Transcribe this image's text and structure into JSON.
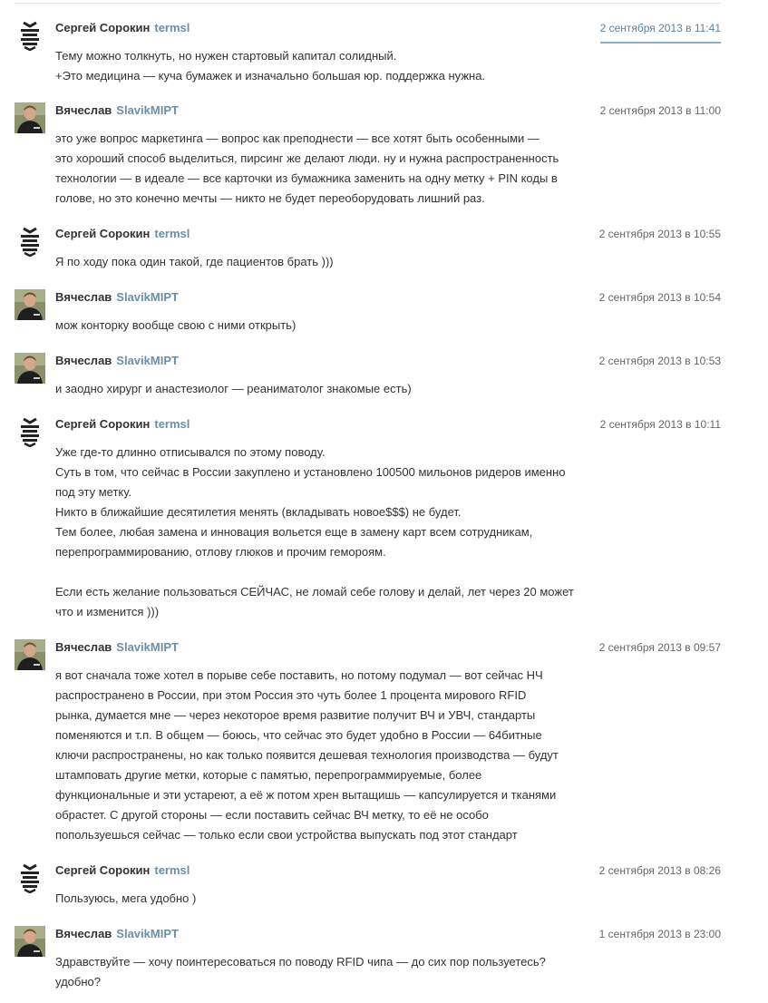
{
  "comments": [
    {
      "author": "Сергей Сорокин",
      "nick": "termsl",
      "avatar": "logo-avatar",
      "time": "2 сентября 2013 в 11:41",
      "active": true,
      "lines": [
        "Тему можно толкнуть, но нужен стартовый капитал солидный.",
        "+Это медицина — куча бумажек и изначально большая юр. поддержка нужна."
      ]
    },
    {
      "author": "Вячеслав",
      "nick": "SlavikMIPT",
      "avatar": "person-avatar",
      "time": "2 сентября 2013 в 11:00",
      "active": false,
      "lines": [
        "это уже вопрос маркетинга — вопрос как преподнести — все хотят быть особенными —",
        "это хороший способ выделиться, пирсинг же делают люди. ну и нужна распространенность",
        "технологии — в идеале — все карточки из бумажника заменить на одну метку + PIN коды в",
        "голове, но это конечно мечты — никто не будет переоборудовать лишний раз."
      ]
    },
    {
      "author": "Сергей Сорокин",
      "nick": "termsl",
      "avatar": "logo-avatar",
      "time": "2 сентября 2013 в 10:55",
      "active": false,
      "lines": [
        "Я по ходу пока один такой, где пациентов брать )))"
      ]
    },
    {
      "author": "Вячеслав",
      "nick": "SlavikMIPT",
      "avatar": "person-avatar",
      "time": "2 сентября 2013 в 10:54",
      "active": false,
      "lines": [
        "мож конторку вообще свою с ними открыть)"
      ]
    },
    {
      "author": "Вячеслав",
      "nick": "SlavikMIPT",
      "avatar": "person-avatar",
      "time": "2 сентября 2013 в 10:53",
      "active": false,
      "lines": [
        "и заодно хирург и анастезиолог — реаниматолог знакомые есть)"
      ]
    },
    {
      "author": "Сергей Сорокин",
      "nick": "termsl",
      "avatar": "logo-avatar",
      "time": "2 сентября 2013 в 10:11",
      "active": false,
      "lines": [
        "Уже где-то длинно отписывался по этому поводу.",
        "Суть в том, что сейчас в России закуплено и установлено 100500 мильонов ридеров именно",
        "под эту метку.",
        "Никто в ближайшие десятилетия менять (вкладывать новое$$$) не будет.",
        "Тем более, любая замена и инновация вольется еще в замену карт всем сотрудникам,",
        "перепрограммированию, отлову глюков и прочим гемороям.",
        "",
        "Если есть желание пользоваться СЕЙЧАС, не ломай себе голову и делай, лет через 20 может",
        "что и изменится )))"
      ]
    },
    {
      "author": "Вячеслав",
      "nick": "SlavikMIPT",
      "avatar": "person-avatar",
      "time": "2 сентября 2013 в 09:57",
      "active": false,
      "lines": [
        "я вот сначала тоже хотел в порыве себе поставить, но потому подумал — вот сейчас НЧ",
        "распространено в России, при этом Россия это чуть более 1 процента мирового RFID",
        "рынка, думается мне — через некоторое время развитие получит ВЧ и УВЧ, стандарты",
        "поменяются и т.п. В общем — боюсь, что сейчас это будет удобно в России — 64битные",
        "ключи распространены, но как только появится дешевая технология производства — будут",
        "штамповать другие метки, которые с памятью, перепрограммируемые, более",
        "функциональные и эти устареют, а её ж потом хрен вытащишь — капсулируется и тканями",
        "обрастет. С другой стороны — если поставить сейчас ВЧ метку, то её не особо",
        "попользуешься сейчас — только если свои устройства выпускать под этот стандарт"
      ]
    },
    {
      "author": "Сергей Сорокин",
      "nick": "termsl",
      "avatar": "logo-avatar",
      "time": "2 сентября 2013 в 08:26",
      "active": false,
      "lines": [
        "Пользуюсь, мега удобно )"
      ]
    },
    {
      "author": "Вячеслав",
      "nick": "SlavikMIPT",
      "avatar": "person-avatar",
      "time": "1 сентября 2013 в 23:00",
      "active": false,
      "lines": [
        "Здравствуйте — хочу поинтересоваться по поводу RFID чипа — до сих пор пользуетесь?",
        "удобно?"
      ]
    }
  ]
}
